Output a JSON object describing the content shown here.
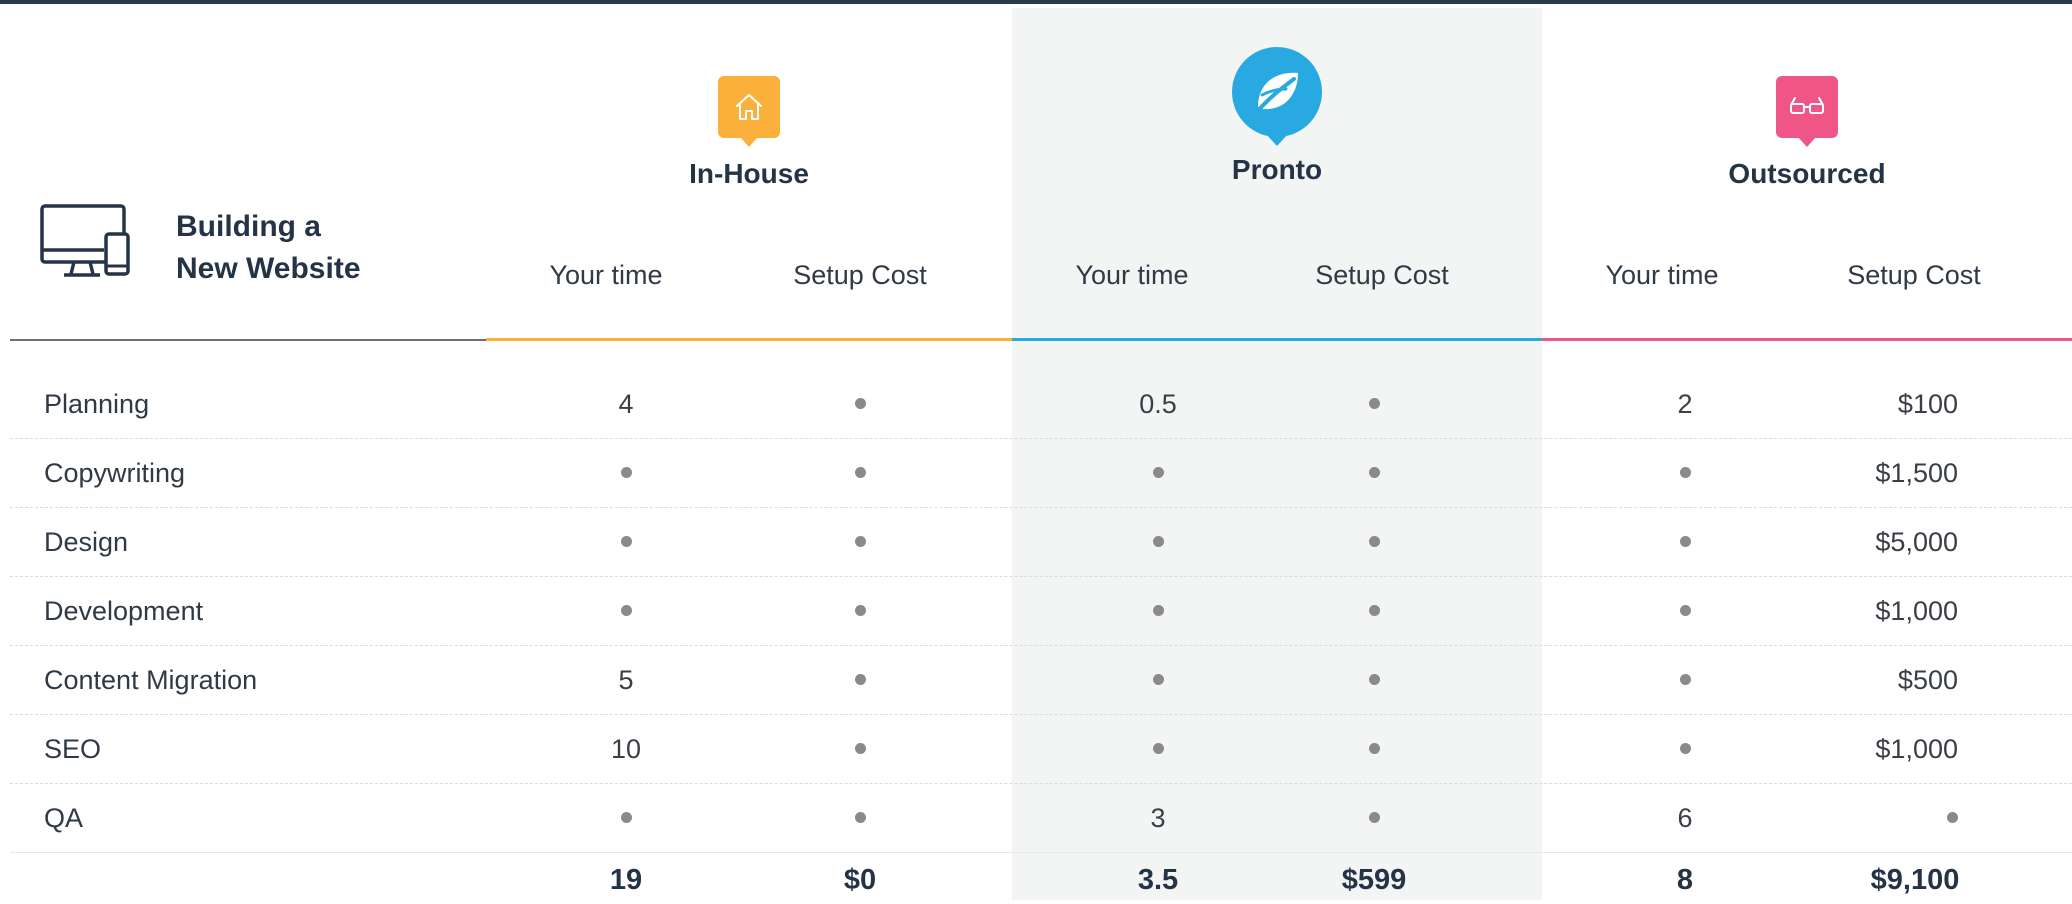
{
  "header": {
    "title": "Building a\nNew Website",
    "icon": "devices-icon"
  },
  "columns": [
    {
      "key": "inhouse",
      "name": "In-House",
      "icon": "house-icon",
      "color": "#fbb03b"
    },
    {
      "key": "pronto",
      "name": "Pronto",
      "icon": "leaf-icon",
      "color": "#29a9e1"
    },
    {
      "key": "outsourced",
      "name": "Outsourced",
      "icon": "glasses-icon",
      "color": "#ef5586"
    }
  ],
  "subheads": {
    "time": "Your time",
    "cost": "Setup Cost"
  },
  "rows": [
    {
      "label": "Planning",
      "inhouse": [
        "4",
        "•"
      ],
      "pronto": [
        "0.5",
        "•"
      ],
      "outsourced": [
        "2",
        "$100"
      ]
    },
    {
      "label": "Copywriting",
      "inhouse": [
        "•",
        "•"
      ],
      "pronto": [
        "•",
        "•"
      ],
      "outsourced": [
        "•",
        "$1,500"
      ]
    },
    {
      "label": "Design",
      "inhouse": [
        "•",
        "•"
      ],
      "pronto": [
        "•",
        "•"
      ],
      "outsourced": [
        "•",
        "$5,000"
      ]
    },
    {
      "label": "Development",
      "inhouse": [
        "•",
        "•"
      ],
      "pronto": [
        "•",
        "•"
      ],
      "outsourced": [
        "•",
        "$1,000"
      ]
    },
    {
      "label": "Content Migration",
      "inhouse": [
        "5",
        "•"
      ],
      "pronto": [
        "•",
        "•"
      ],
      "outsourced": [
        "•",
        "$500"
      ]
    },
    {
      "label": "SEO",
      "inhouse": [
        "10",
        "•"
      ],
      "pronto": [
        "•",
        "•"
      ],
      "outsourced": [
        "•",
        "$1,000"
      ]
    },
    {
      "label": "QA",
      "inhouse": [
        "•",
        "•"
      ],
      "pronto": [
        "3",
        "•"
      ],
      "outsourced": [
        "6",
        "•"
      ]
    }
  ],
  "totals": {
    "inhouse": [
      "19",
      "$0"
    ],
    "pronto": [
      "3.5",
      "$599"
    ],
    "outsourced": [
      "8",
      "$9,100"
    ]
  }
}
